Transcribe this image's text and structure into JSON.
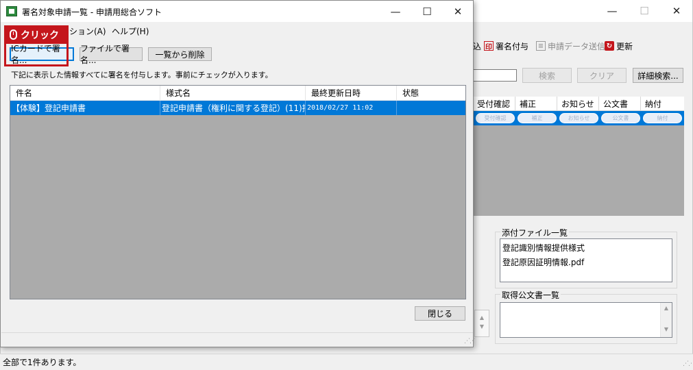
{
  "background_window": {
    "toolbar": {
      "partial_item": "込",
      "sign": "署名付与",
      "send": "申請データ送信",
      "refresh": "更新"
    },
    "search": {
      "value": "",
      "search_btn": "検索",
      "clear_btn": "クリア",
      "detail_btn": "詳細検索..."
    },
    "grid_headers": [
      "受付確認",
      "補正",
      "お知らせ",
      "公文書",
      "納付"
    ],
    "row_pills": [
      "受付確認",
      "補正",
      "お知らせ",
      "公文書",
      "納付"
    ],
    "attachments": {
      "title": "添付ファイル一覧",
      "items": [
        "登記識別情報提供様式",
        "登記原因証明情報.pdf"
      ]
    },
    "official_docs": {
      "title": "取得公文書一覧",
      "items": []
    },
    "status": "全部で1件あります。"
  },
  "dialog": {
    "title": "署名対象申請一覧 - 申請用総合ソフト",
    "menu": {
      "option": "ション(A)",
      "help": "ヘルプ(H)"
    },
    "buttons": {
      "ic_sign": "ICカードで署名...",
      "file_sign": "ファイルで署名...",
      "remove": "一覧から削除",
      "close": "閉じる"
    },
    "instruction": "下記に表示した情報すべてに署名を付与します。事前にチェックが入ります。",
    "columns": [
      "件名",
      "様式名",
      "最終更新日時",
      "状態"
    ],
    "rows": [
      {
        "subject": "【体験】登記申請書",
        "form": "登記申請書（権利に関する登記）(11)抵...",
        "updated": "2018/02/27 11:02",
        "status": ""
      }
    ]
  },
  "callout": {
    "label": "クリック",
    "color": "#c4161c"
  },
  "window_controls": {
    "minimize": "—",
    "maximize": "☐",
    "close": "✕"
  },
  "accent_color": "#0078d7"
}
